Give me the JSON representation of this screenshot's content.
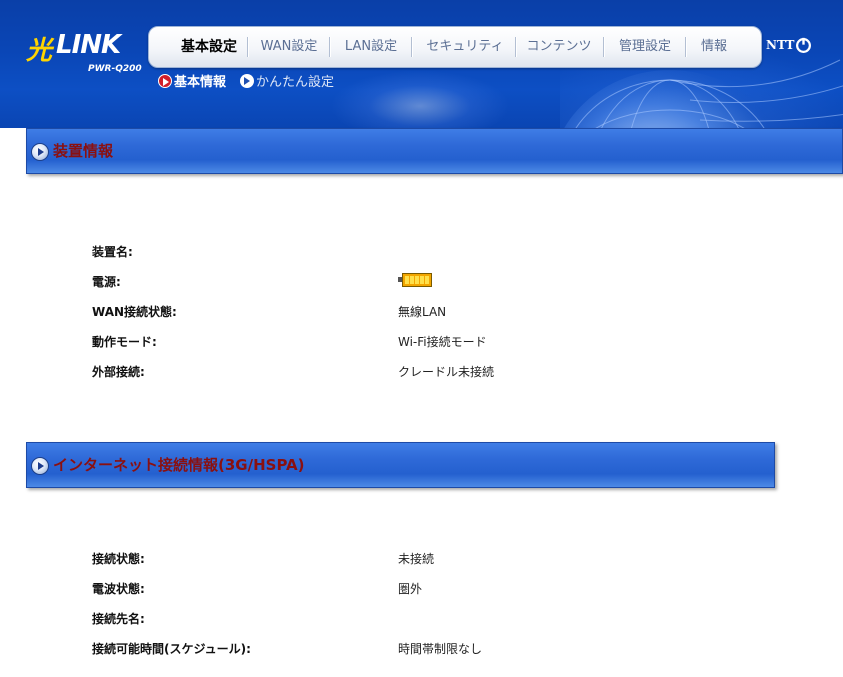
{
  "header": {
    "logo_hikari": "光",
    "logo_link": "LINK",
    "model": "PWR-Q200",
    "ntt": "NTT",
    "nav": [
      {
        "label": "基本設定",
        "active": true
      },
      {
        "label": "WAN設定",
        "active": false
      },
      {
        "label": "LAN設定",
        "active": false
      },
      {
        "label": "セキュリティ",
        "active": false
      },
      {
        "label": "コンテンツ",
        "active": false
      },
      {
        "label": "管理設定",
        "active": false
      },
      {
        "label": "情報",
        "active": false
      }
    ],
    "subnav": [
      {
        "label": "基本情報",
        "active": true
      },
      {
        "label": "かんたん設定",
        "active": false
      }
    ]
  },
  "device_section": {
    "title": "装置情報",
    "rows": [
      {
        "label": "装置名:",
        "value": ""
      },
      {
        "label": "電源:",
        "value": "",
        "battery_level": 1.0
      },
      {
        "label": "WAN接続状態:",
        "value": "無線LAN"
      },
      {
        "label": "動作モード:",
        "value": "Wi-Fi接続モード"
      },
      {
        "label": "外部接続:",
        "value": "クレードル未接続"
      }
    ]
  },
  "internet_section": {
    "title": "インターネット接続情報(3G/HSPA)",
    "rows": [
      {
        "label": "接続状態:",
        "value": "未接続"
      },
      {
        "label": "電波状態:",
        "value": "圏外"
      },
      {
        "label": "接続先名:",
        "value": ""
      },
      {
        "label": "接続可能時間(スケジュール):",
        "value": "時間帯制限なし"
      }
    ]
  },
  "colors": {
    "header_blue": "#0a46b6",
    "section_title": "#8a1010",
    "logo_yellow": "#ffd400",
    "battery": "#f3a600"
  },
  "icons": {
    "section_bullet": "arrow-circle-icon",
    "subnav_active": "red-arrow-circle-icon",
    "subnav_inactive": "white-arrow-circle-icon",
    "ntt_logo": "ntt-logo-icon",
    "battery": "battery-icon"
  }
}
